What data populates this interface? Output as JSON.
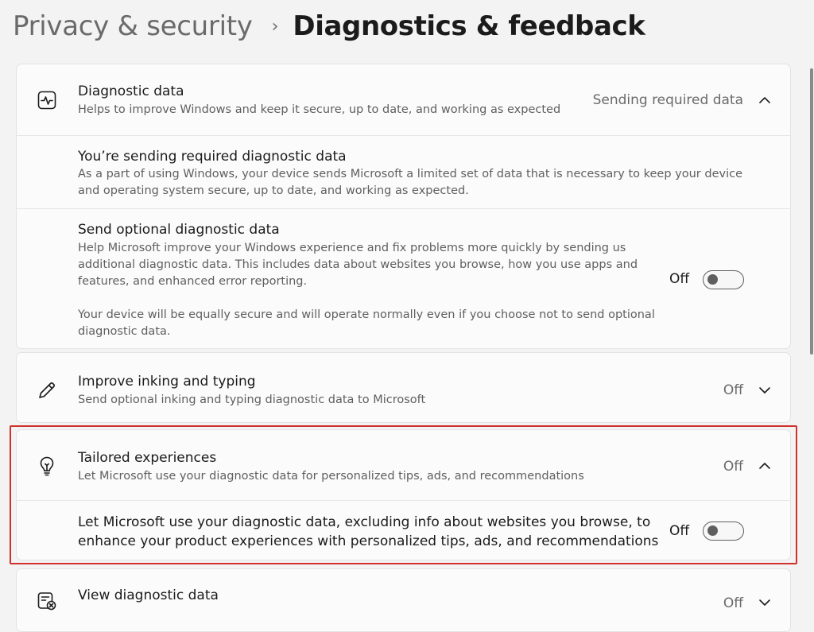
{
  "breadcrumb": {
    "parent": "Privacy & security",
    "separator": "›",
    "current": "Diagnostics & feedback"
  },
  "diagnostic_data": {
    "icon": "activity-pulse-icon",
    "title": "Diagnostic data",
    "description": "Helps to improve Windows and keep it secure, up to date, and working as expected",
    "status": "Sending required data",
    "expanded": true,
    "required": {
      "title": "You’re sending required diagnostic data",
      "lines": [
        "As a part of using Windows, your device sends Microsoft a limited set of data that is necessary to keep your device",
        "and operating system secure, up to date, and working as expected."
      ]
    },
    "optional": {
      "title": "Send optional diagnostic data",
      "lines": [
        "Help Microsoft improve your Windows experience and fix problems more quickly by sending us",
        "additional diagnostic data. This includes data about websites you browse, how you use apps and",
        "features, and enhanced error reporting."
      ],
      "note_lines": [
        "Your device will be equally secure and will operate normally even if you choose not to send optional",
        "diagnostic data."
      ],
      "toggle_label": "Off",
      "toggle_on": false
    }
  },
  "inking": {
    "icon": "pen-icon",
    "title": "Improve inking and typing",
    "description": "Send optional inking and typing diagnostic data to Microsoft",
    "status": "Off"
  },
  "tailored": {
    "icon": "lightbulb-icon",
    "title": "Tailored experiences",
    "description": "Let Microsoft use your diagnostic data for personalized tips, ads, and recommendations",
    "status": "Off",
    "expanded": true,
    "detail_lines": [
      "Let Microsoft use your diagnostic data, excluding info about websites you browse, to",
      "enhance your product experiences with personalized tips, ads, and recommendations"
    ],
    "toggle_label": "Off",
    "toggle_on": false
  },
  "view_data": {
    "icon": "view-data-icon",
    "title": "View diagnostic data",
    "status": "Off"
  },
  "colors": {
    "highlight": "#d0312d",
    "background": "#f3f3f3",
    "card": "#fbfbfb"
  }
}
